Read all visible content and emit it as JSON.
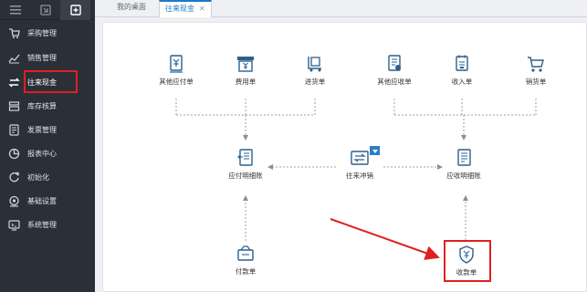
{
  "sidebar": {
    "items": [
      {
        "label": "采购管理",
        "icon": "purchase-icon"
      },
      {
        "label": "销售管理",
        "icon": "sales-icon"
      },
      {
        "label": "往来现金",
        "icon": "cash-icon"
      },
      {
        "label": "库存核算",
        "icon": "inventory-icon"
      },
      {
        "label": "发票管理",
        "icon": "invoice-icon"
      },
      {
        "label": "报表中心",
        "icon": "report-icon"
      },
      {
        "label": "初始化",
        "icon": "init-icon"
      },
      {
        "label": "基础设置",
        "icon": "settings-icon"
      },
      {
        "label": "系统管理",
        "icon": "system-icon"
      }
    ],
    "highlighted_item": "往来现金"
  },
  "tabs": [
    {
      "label": "我的桌面",
      "active": false
    },
    {
      "label": "往来现金",
      "active": true,
      "close": "✕"
    }
  ],
  "flow": {
    "top": [
      {
        "label": "其他应付单",
        "icon": "payable-doc-icon"
      },
      {
        "label": "费用单",
        "icon": "expense-register-icon"
      },
      {
        "label": "进货单",
        "icon": "purchase-cart-icon"
      },
      {
        "label": "其他应收单",
        "icon": "receivable-doc-icon"
      },
      {
        "label": "收入单",
        "icon": "income-doc-icon"
      },
      {
        "label": "销货单",
        "icon": "sales-cart-icon"
      }
    ],
    "middle": {
      "payable_detail": "应付明细账",
      "offset": "往来冲销",
      "receivable_detail": "应收明细账"
    },
    "bottom": {
      "payment": "付款单",
      "receipt": "收款单"
    }
  },
  "colors": {
    "sidebar_bg": "#2b3038",
    "accent": "#1f79c4",
    "highlight": "#e02020"
  }
}
